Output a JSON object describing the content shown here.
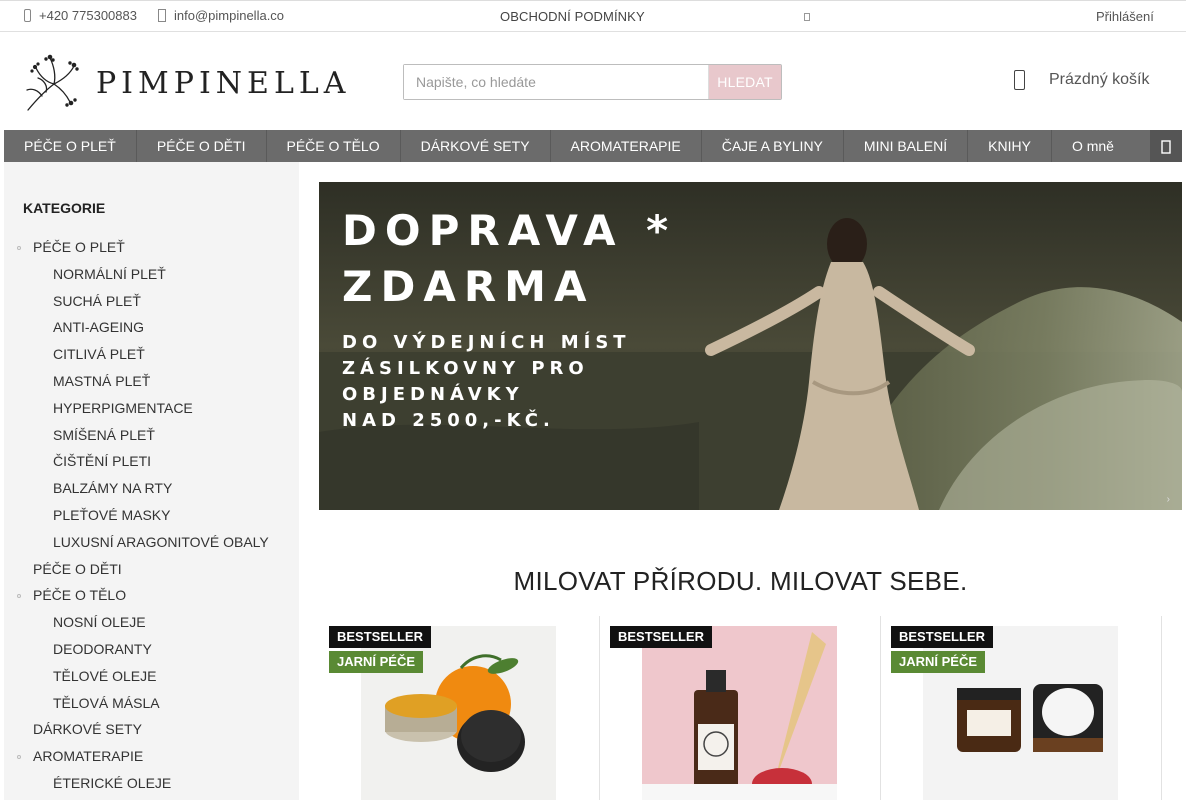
{
  "topbar": {
    "phone": "+420 775300883",
    "email": "info@pimpinella.co",
    "terms": "OBCHODNÍ PODMÍNKY",
    "login": "Přihlášení"
  },
  "header": {
    "brand": "PIMPINELLA",
    "search_placeholder": "Napište, co hledáte",
    "search_button": "HLEDAT",
    "cart": "Prázdný košík"
  },
  "nav": {
    "items": [
      "PÉČE O PLEŤ",
      "PÉČE O DĚTI",
      "PÉČE O TĚLO",
      "DÁRKOVÉ SETY",
      "AROMATERAPIE",
      "ČAJE A BYLINY",
      "MINI BALENÍ",
      "KNIHY",
      "O mně"
    ]
  },
  "sidebar": {
    "title": "KATEGORIE",
    "items": [
      {
        "label": "PÉČE O PLEŤ",
        "level": 1,
        "bullet": true
      },
      {
        "label": "NORMÁLNÍ PLEŤ",
        "level": 2
      },
      {
        "label": "SUCHÁ PLEŤ",
        "level": 2
      },
      {
        "label": "ANTI-AGEING",
        "level": 2
      },
      {
        "label": "CITLIVÁ PLEŤ",
        "level": 2
      },
      {
        "label": "MASTNÁ PLEŤ",
        "level": 2
      },
      {
        "label": "HYPERPIGMENTACE",
        "level": 2
      },
      {
        "label": "SMÍŠENÁ PLEŤ",
        "level": 2
      },
      {
        "label": "ČIŠTĚNÍ PLETI",
        "level": 2
      },
      {
        "label": "BALZÁMY NA RTY",
        "level": 2
      },
      {
        "label": "PLEŤOVÉ MASKY",
        "level": 2
      },
      {
        "label": "LUXUSNÍ ARAGONITOVÉ OBALY",
        "level": 2
      },
      {
        "label": "PÉČE O DĚTI",
        "level": 1,
        "bullet": false
      },
      {
        "label": "PÉČE O TĚLO",
        "level": 1,
        "bullet": true
      },
      {
        "label": "NOSNÍ OLEJE",
        "level": 2
      },
      {
        "label": "DEODORANTY",
        "level": 2
      },
      {
        "label": "TĚLOVÉ OLEJE",
        "level": 2
      },
      {
        "label": "TĚLOVÁ MÁSLA",
        "level": 2
      },
      {
        "label": "DÁRKOVÉ SETY",
        "level": 1,
        "bullet": false
      },
      {
        "label": "AROMATERAPIE",
        "level": 1,
        "bullet": true
      },
      {
        "label": "ÉTERICKÉ OLEJE",
        "level": 2
      }
    ]
  },
  "banner": {
    "line1": "DOPRAVA *",
    "line2": "ZDARMA",
    "line3": "DO VÝDEJNÍCH MÍST",
    "line4": "ZÁSILKOVNY PRO",
    "line5": "OBJEDNÁVKY",
    "line6": "NAD 2500,-KČ."
  },
  "headline": "MILOVAT PŘÍRODU. MILOVAT SEBE.",
  "products": [
    {
      "badge1": "BESTSELLER",
      "badge2": "JARNÍ PÉČE"
    },
    {
      "badge1": "BESTSELLER",
      "badge2": ""
    },
    {
      "badge1": "BESTSELLER",
      "badge2": "JARNÍ PÉČE"
    }
  ],
  "colors": {
    "nav_bg": "#6b6b6b",
    "search_button": "#e8c8cc",
    "badge_best": "#111111",
    "badge_spring": "#5a8a34",
    "sidebar_bg": "#f4f4f4"
  }
}
